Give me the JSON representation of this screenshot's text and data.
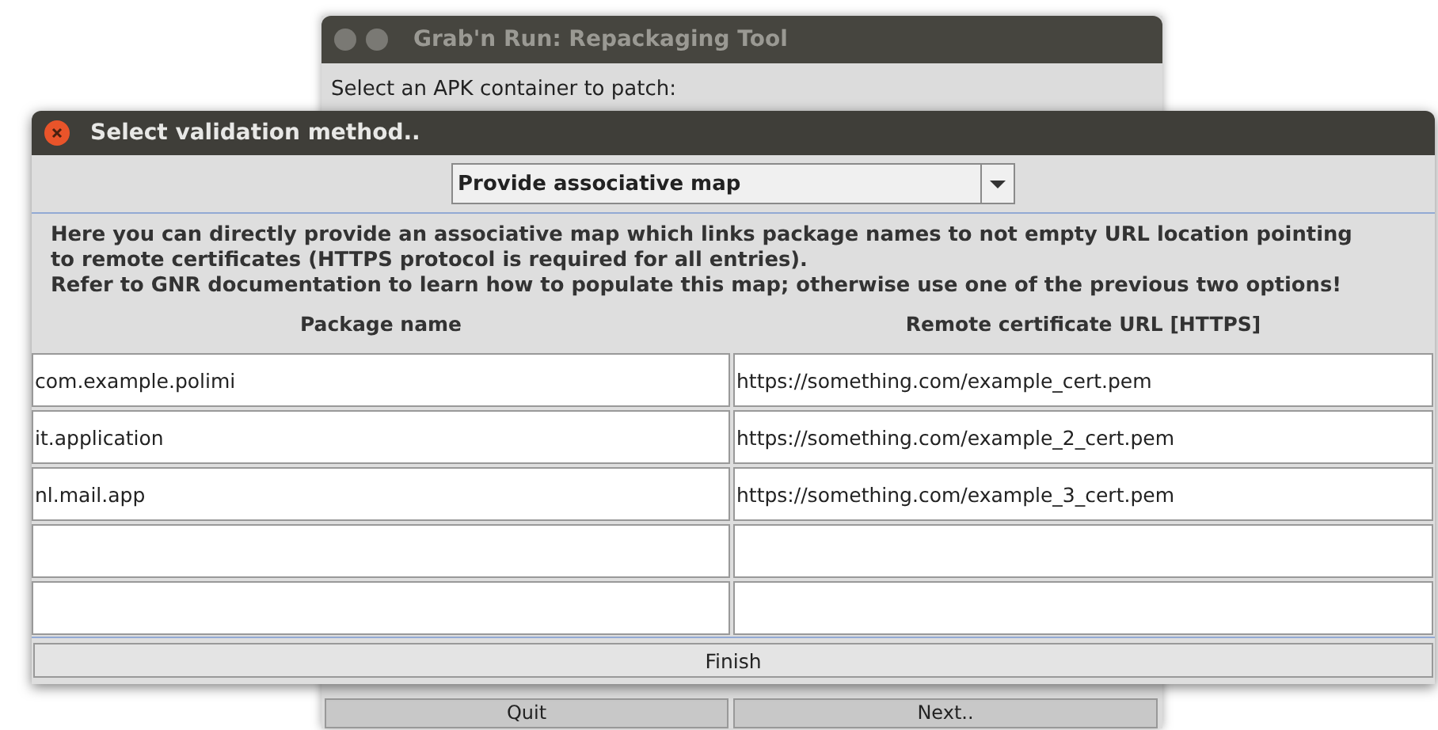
{
  "back_window": {
    "title": "Grab'n Run: Repackaging Tool",
    "prompt": "Select an APK container to patch:",
    "buttons": [
      "Quit",
      "Next.."
    ]
  },
  "dialog": {
    "title": "Select validation method..",
    "method": {
      "value": "Provide associative map"
    },
    "description": [
      "Here you can directly provide an associative map which links package names to not empty URL location pointing",
      "to remote certificates (HTTPS protocol is required for all entries).",
      "Refer to GNR documentation to learn how to populate this map; otherwise use one of the previous two options!"
    ],
    "table": {
      "columns": [
        "Package name",
        "Remote certificate URL [HTTPS]"
      ],
      "rows": [
        {
          "kind": "filled",
          "package": "com.example.polimi",
          "url": "https://something.com/example_cert.pem"
        },
        {
          "kind": "filled",
          "package": "it.application",
          "url": "https://something.com/example_2_cert.pem"
        },
        {
          "kind": "filled",
          "package": "nl.mail.app",
          "url": "https://something.com/example_3_cert.pem"
        },
        {
          "kind": "empty"
        },
        {
          "kind": "empty"
        }
      ]
    },
    "finish_button": "Finish"
  }
}
